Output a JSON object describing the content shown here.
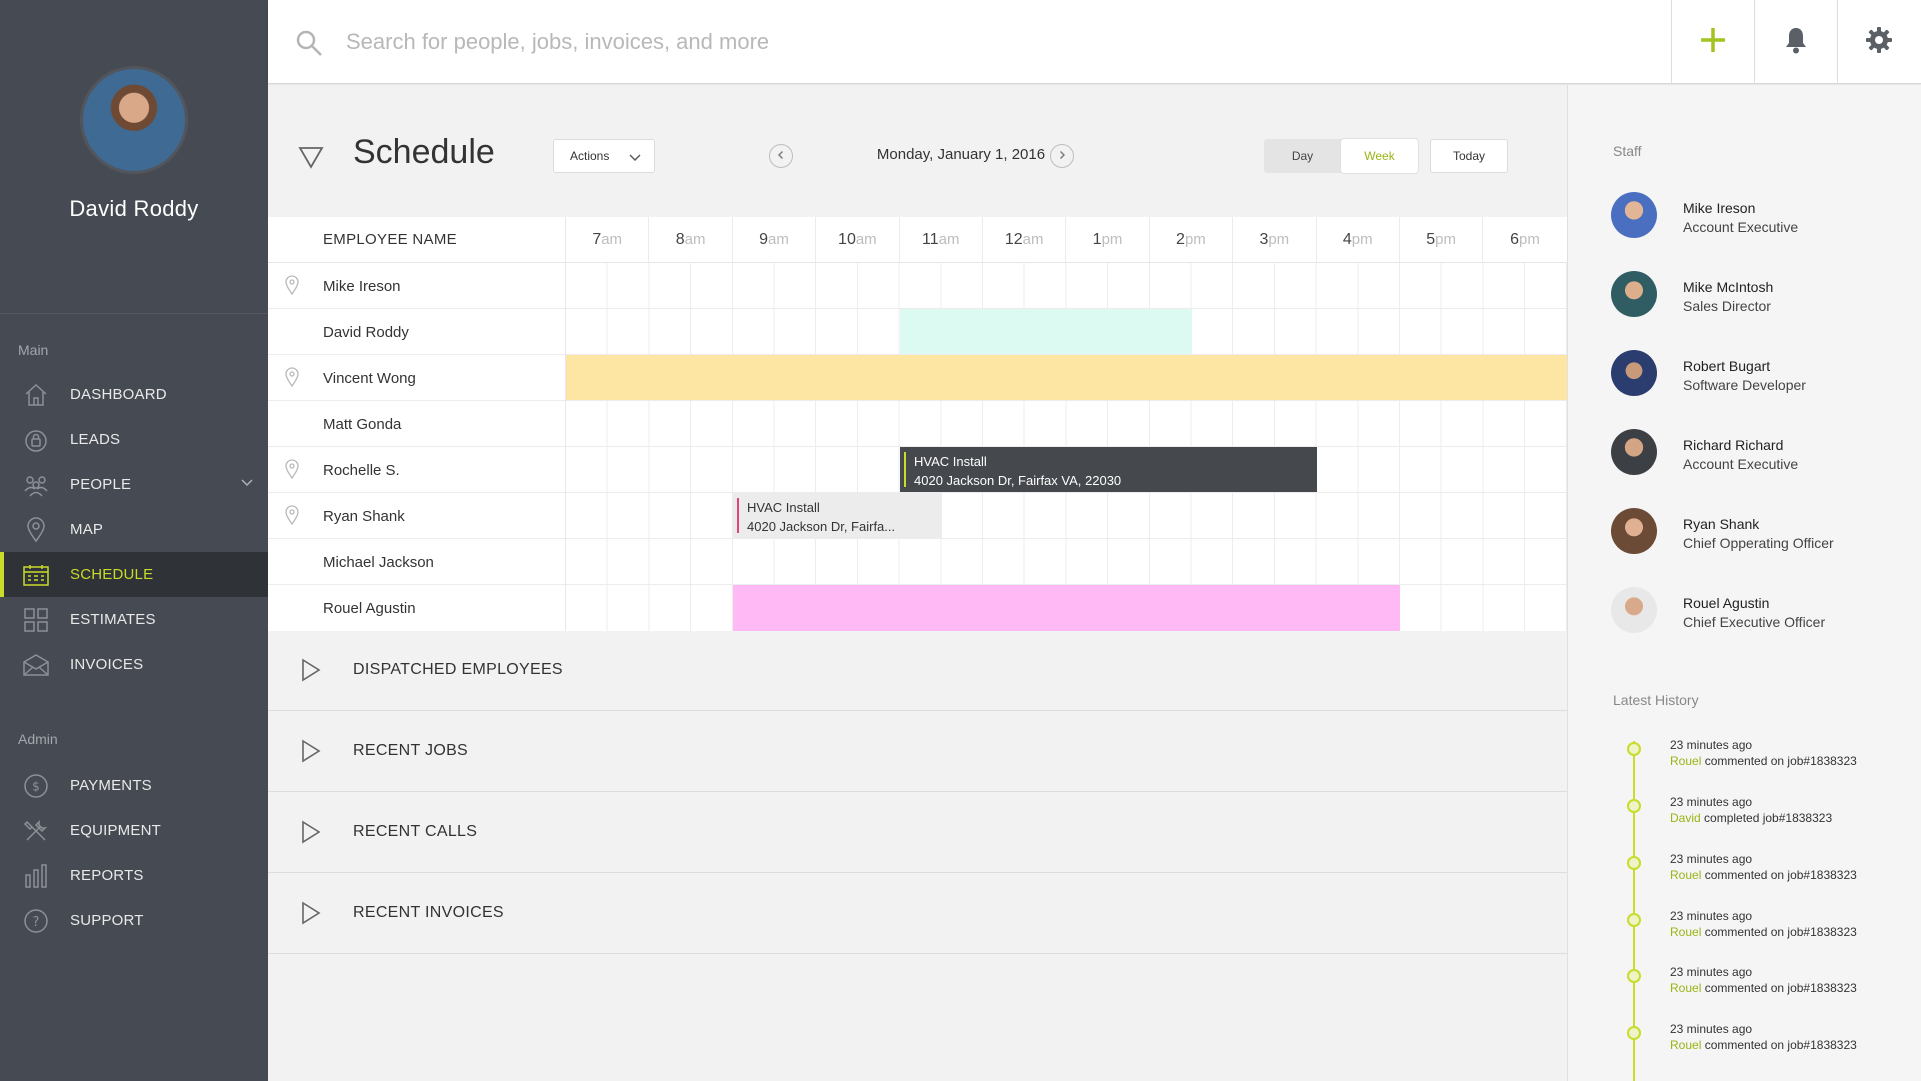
{
  "profile": {
    "name": "David Roddy"
  },
  "sidebar": {
    "main_label": "Main",
    "admin_label": "Admin",
    "main_items": [
      {
        "label": "DASHBOARD",
        "icon": "home-icon"
      },
      {
        "label": "LEADS",
        "icon": "lock-icon"
      },
      {
        "label": "PEOPLE",
        "icon": "people-icon"
      },
      {
        "label": "MAP",
        "icon": "map-pin-icon"
      },
      {
        "label": "SCHEDULE",
        "icon": "calendar-icon",
        "active": true
      },
      {
        "label": "ESTIMATES",
        "icon": "grid-icon"
      },
      {
        "label": "INVOICES",
        "icon": "envelope-icon"
      }
    ],
    "admin_items": [
      {
        "label": "PAYMENTS",
        "icon": "dollar-icon"
      },
      {
        "label": "EQUIPMENT",
        "icon": "tools-icon"
      },
      {
        "label": "REPORTS",
        "icon": "bar-chart-icon"
      },
      {
        "label": "SUPPORT",
        "icon": "help-icon"
      }
    ]
  },
  "topbar": {
    "search_placeholder": "Search for people, jobs, invoices, and more"
  },
  "schedule": {
    "title": "Schedule",
    "actions_label": "Actions",
    "date": "Monday, January 1, 2016",
    "view_day": "Day",
    "view_week": "Week",
    "view_today": "Today",
    "column_header": "EMPLOYEE NAME",
    "hours": [
      {
        "n": "7",
        "ap": "am"
      },
      {
        "n": "8",
        "ap": "am"
      },
      {
        "n": "9",
        "ap": "am"
      },
      {
        "n": "10",
        "ap": "am"
      },
      {
        "n": "11",
        "ap": "am"
      },
      {
        "n": "12",
        "ap": "am"
      },
      {
        "n": "1",
        "ap": "pm"
      },
      {
        "n": "2",
        "ap": "pm"
      },
      {
        "n": "3",
        "ap": "pm"
      },
      {
        "n": "4",
        "ap": "pm"
      },
      {
        "n": "5",
        "ap": "pm"
      },
      {
        "n": "6",
        "ap": "pm"
      }
    ],
    "employees": [
      {
        "name": "Mike Ireson",
        "pin": true
      },
      {
        "name": "David Roddy",
        "pin": false
      },
      {
        "name": "Vincent Wong",
        "pin": true
      },
      {
        "name": "Matt Gonda",
        "pin": false
      },
      {
        "name": "Rochelle S.",
        "pin": true
      },
      {
        "name": "Ryan Shank",
        "pin": true
      },
      {
        "name": "Michael Jackson",
        "pin": false
      },
      {
        "name": "Rouel Agustin",
        "pin": false
      }
    ],
    "events": {
      "rochelle": {
        "title": "HVAC Install",
        "address": "4020 Jackson Dr, Fairfax VA, 22030"
      },
      "ryan": {
        "title": "HVAC Install",
        "address": "4020 Jackson Dr, Fairfa..."
      }
    },
    "colors": {
      "mint": "#dcfaf2",
      "yellow": "#fde6a4",
      "pink": "#ffb9f4",
      "accent": "#c9dc2b"
    }
  },
  "sections": [
    "DISPATCHED EMPLOYEES",
    "RECENT JOBS",
    "RECENT CALLS",
    "RECENT INVOICES"
  ],
  "right_panel": {
    "staff_label": "Staff",
    "history_label": "Latest History",
    "staff": [
      {
        "name": "Mike Ireson",
        "role": "Account Executive"
      },
      {
        "name": "Mike McIntosh",
        "role": "Sales Director"
      },
      {
        "name": "Robert Bugart",
        "role": "Software Developer"
      },
      {
        "name": "Richard Richard",
        "role": "Account Executive"
      },
      {
        "name": "Ryan Shank",
        "role": "Chief Opperating Officer"
      },
      {
        "name": "Rouel Agustin",
        "role": "Chief Executive Officer"
      }
    ],
    "history": [
      {
        "time": "23 minutes ago",
        "user": "Rouel",
        "text": " commented on job#1838323"
      },
      {
        "time": "23 minutes ago",
        "user": "David",
        "text": " completed job#1838323"
      },
      {
        "time": "23 minutes ago",
        "user": "Rouel",
        "text": " commented on job#1838323"
      },
      {
        "time": "23 minutes ago",
        "user": "Rouel",
        "text": " commented on job#1838323"
      },
      {
        "time": "23 minutes ago",
        "user": "Rouel",
        "text": " commented on job#1838323"
      },
      {
        "time": "23 minutes ago",
        "user": "Rouel",
        "text": " commented on job#1838323"
      }
    ]
  }
}
